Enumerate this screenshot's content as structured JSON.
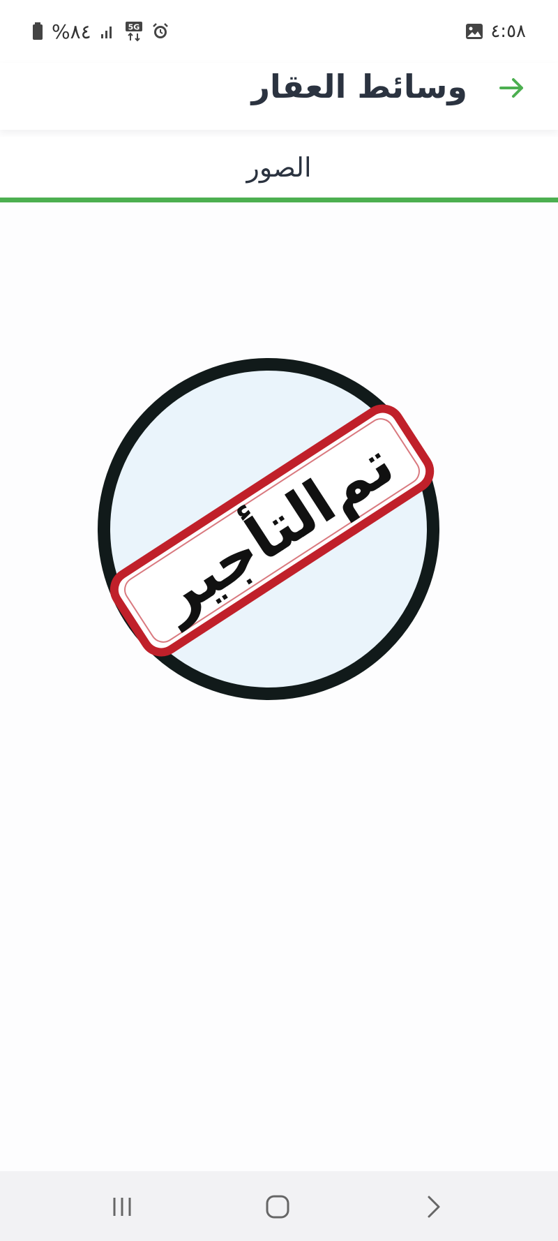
{
  "status_bar": {
    "time": "٤:٥٨",
    "battery": "%٨٤",
    "network": "5G",
    "icons": [
      "gallery-icon",
      "alarm-icon",
      "5g-icon",
      "signal-icon",
      "battery-icon"
    ]
  },
  "header": {
    "title": "وسائط العقار",
    "back_icon": "arrow-right-icon"
  },
  "tabs": [
    {
      "label": "الصور",
      "active": true
    }
  ],
  "media": {
    "stamp_text_top": "تم",
    "stamp_text_bottom": "التأجير"
  },
  "nav_bar": {
    "icons": [
      "recent-apps-icon",
      "home-icon",
      "back-icon"
    ]
  },
  "colors": {
    "accent": "#4caf50",
    "stamp_red": "#c0202a",
    "circle": "#111a1a",
    "circle_fill": "#eaf4fb"
  }
}
